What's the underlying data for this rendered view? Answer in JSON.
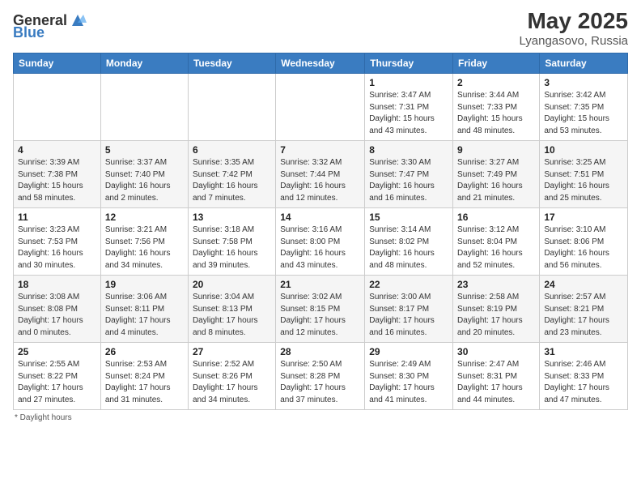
{
  "header": {
    "logo_general": "General",
    "logo_blue": "Blue",
    "month_year": "May 2025",
    "location": "Lyangasovo, Russia"
  },
  "days_of_week": [
    "Sunday",
    "Monday",
    "Tuesday",
    "Wednesday",
    "Thursday",
    "Friday",
    "Saturday"
  ],
  "weeks": [
    [
      {
        "day": "",
        "info": ""
      },
      {
        "day": "",
        "info": ""
      },
      {
        "day": "",
        "info": ""
      },
      {
        "day": "",
        "info": ""
      },
      {
        "day": "1",
        "info": "Sunrise: 3:47 AM\nSunset: 7:31 PM\nDaylight: 15 hours and 43 minutes."
      },
      {
        "day": "2",
        "info": "Sunrise: 3:44 AM\nSunset: 7:33 PM\nDaylight: 15 hours and 48 minutes."
      },
      {
        "day": "3",
        "info": "Sunrise: 3:42 AM\nSunset: 7:35 PM\nDaylight: 15 hours and 53 minutes."
      }
    ],
    [
      {
        "day": "4",
        "info": "Sunrise: 3:39 AM\nSunset: 7:38 PM\nDaylight: 15 hours and 58 minutes."
      },
      {
        "day": "5",
        "info": "Sunrise: 3:37 AM\nSunset: 7:40 PM\nDaylight: 16 hours and 2 minutes."
      },
      {
        "day": "6",
        "info": "Sunrise: 3:35 AM\nSunset: 7:42 PM\nDaylight: 16 hours and 7 minutes."
      },
      {
        "day": "7",
        "info": "Sunrise: 3:32 AM\nSunset: 7:44 PM\nDaylight: 16 hours and 12 minutes."
      },
      {
        "day": "8",
        "info": "Sunrise: 3:30 AM\nSunset: 7:47 PM\nDaylight: 16 hours and 16 minutes."
      },
      {
        "day": "9",
        "info": "Sunrise: 3:27 AM\nSunset: 7:49 PM\nDaylight: 16 hours and 21 minutes."
      },
      {
        "day": "10",
        "info": "Sunrise: 3:25 AM\nSunset: 7:51 PM\nDaylight: 16 hours and 25 minutes."
      }
    ],
    [
      {
        "day": "11",
        "info": "Sunrise: 3:23 AM\nSunset: 7:53 PM\nDaylight: 16 hours and 30 minutes."
      },
      {
        "day": "12",
        "info": "Sunrise: 3:21 AM\nSunset: 7:56 PM\nDaylight: 16 hours and 34 minutes."
      },
      {
        "day": "13",
        "info": "Sunrise: 3:18 AM\nSunset: 7:58 PM\nDaylight: 16 hours and 39 minutes."
      },
      {
        "day": "14",
        "info": "Sunrise: 3:16 AM\nSunset: 8:00 PM\nDaylight: 16 hours and 43 minutes."
      },
      {
        "day": "15",
        "info": "Sunrise: 3:14 AM\nSunset: 8:02 PM\nDaylight: 16 hours and 48 minutes."
      },
      {
        "day": "16",
        "info": "Sunrise: 3:12 AM\nSunset: 8:04 PM\nDaylight: 16 hours and 52 minutes."
      },
      {
        "day": "17",
        "info": "Sunrise: 3:10 AM\nSunset: 8:06 PM\nDaylight: 16 hours and 56 minutes."
      }
    ],
    [
      {
        "day": "18",
        "info": "Sunrise: 3:08 AM\nSunset: 8:08 PM\nDaylight: 17 hours and 0 minutes."
      },
      {
        "day": "19",
        "info": "Sunrise: 3:06 AM\nSunset: 8:11 PM\nDaylight: 17 hours and 4 minutes."
      },
      {
        "day": "20",
        "info": "Sunrise: 3:04 AM\nSunset: 8:13 PM\nDaylight: 17 hours and 8 minutes."
      },
      {
        "day": "21",
        "info": "Sunrise: 3:02 AM\nSunset: 8:15 PM\nDaylight: 17 hours and 12 minutes."
      },
      {
        "day": "22",
        "info": "Sunrise: 3:00 AM\nSunset: 8:17 PM\nDaylight: 17 hours and 16 minutes."
      },
      {
        "day": "23",
        "info": "Sunrise: 2:58 AM\nSunset: 8:19 PM\nDaylight: 17 hours and 20 minutes."
      },
      {
        "day": "24",
        "info": "Sunrise: 2:57 AM\nSunset: 8:21 PM\nDaylight: 17 hours and 23 minutes."
      }
    ],
    [
      {
        "day": "25",
        "info": "Sunrise: 2:55 AM\nSunset: 8:22 PM\nDaylight: 17 hours and 27 minutes."
      },
      {
        "day": "26",
        "info": "Sunrise: 2:53 AM\nSunset: 8:24 PM\nDaylight: 17 hours and 31 minutes."
      },
      {
        "day": "27",
        "info": "Sunrise: 2:52 AM\nSunset: 8:26 PM\nDaylight: 17 hours and 34 minutes."
      },
      {
        "day": "28",
        "info": "Sunrise: 2:50 AM\nSunset: 8:28 PM\nDaylight: 17 hours and 37 minutes."
      },
      {
        "day": "29",
        "info": "Sunrise: 2:49 AM\nSunset: 8:30 PM\nDaylight: 17 hours and 41 minutes."
      },
      {
        "day": "30",
        "info": "Sunrise: 2:47 AM\nSunset: 8:31 PM\nDaylight: 17 hours and 44 minutes."
      },
      {
        "day": "31",
        "info": "Sunrise: 2:46 AM\nSunset: 8:33 PM\nDaylight: 17 hours and 47 minutes."
      }
    ]
  ],
  "footer": {
    "note": "Daylight hours"
  }
}
